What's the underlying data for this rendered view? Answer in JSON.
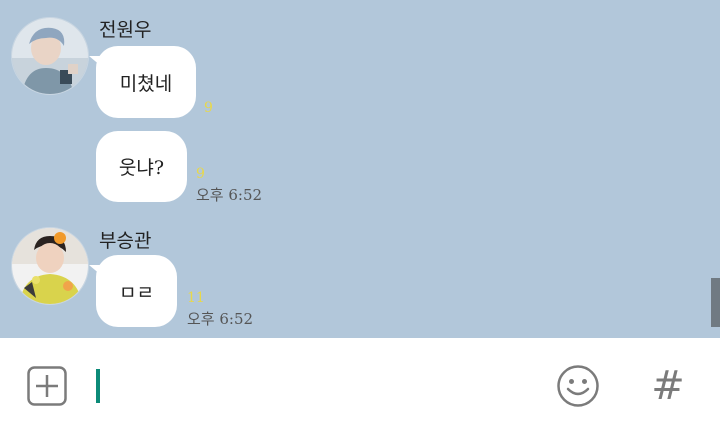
{
  "messages": [
    {
      "sender": "전원우",
      "text": "미쳤네",
      "unread": "9",
      "time": ""
    },
    {
      "sender": "",
      "text": "웃냐?",
      "unread": "9",
      "time": "오후 6:52"
    },
    {
      "sender": "부승관",
      "text": "ㅁㄹ",
      "unread": "11",
      "time": "오후 6:52"
    }
  ],
  "input": {
    "value": ""
  },
  "icons": {
    "add": "plus-square-icon",
    "emoji": "smiley-icon",
    "hashtag": "hash-icon"
  },
  "hashtag_glyph": "#",
  "colors": {
    "chat_background": "#b2c7da",
    "bubble": "#ffffff",
    "unread": "#e8d84a",
    "cursor": "#0c8a78"
  }
}
